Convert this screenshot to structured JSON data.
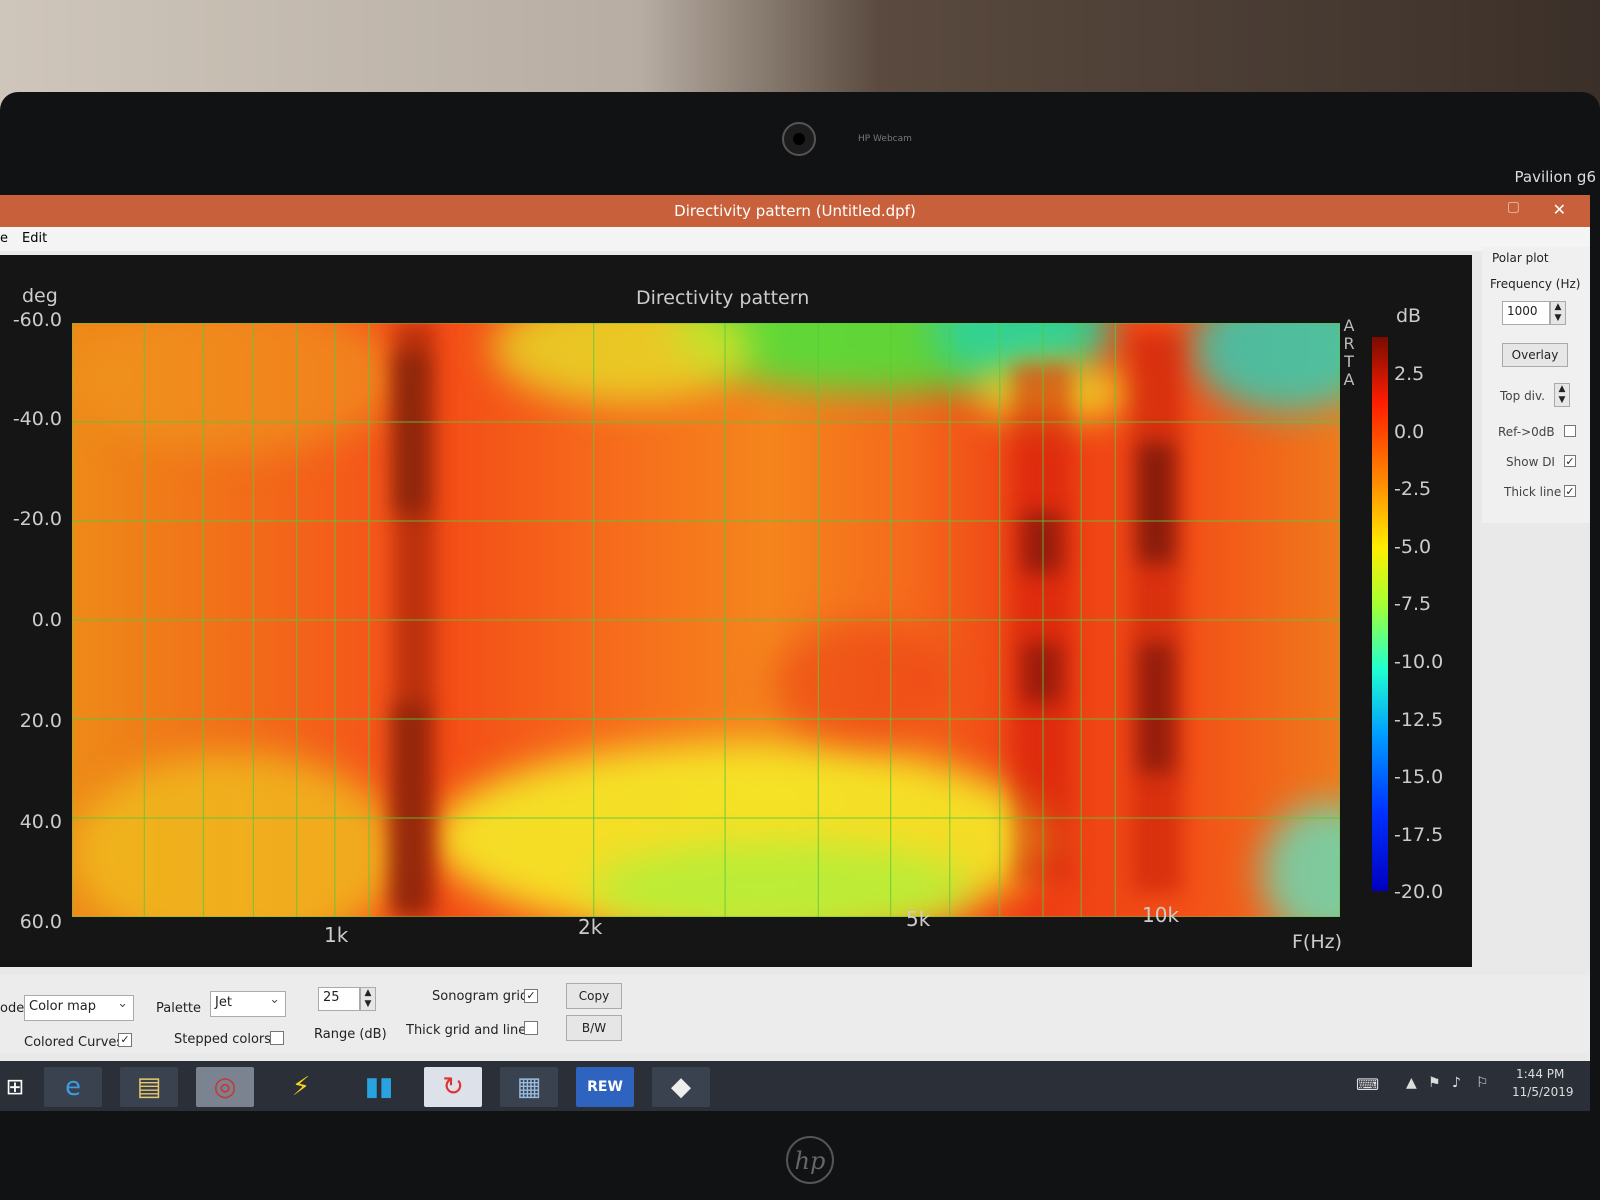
{
  "laptop": {
    "brand_label": "Pavilion g6",
    "cam_label": "HP Webcam",
    "logo": "hp"
  },
  "window": {
    "title": "Directivity pattern (Untitled.dpf)",
    "close_glyph": "✕",
    "maximize_glyph": "▢"
  },
  "menu": {
    "items": [
      "e",
      "Edit"
    ]
  },
  "chart": {
    "title": "Directivity pattern",
    "ylabel": "deg",
    "xlabel": "F(Hz)",
    "watermark": [
      "A",
      "R",
      "T",
      "A"
    ],
    "colorbar_label": "dB",
    "colorbar_ticks": [
      "2.5",
      "0.0",
      "-2.5",
      "-5.0",
      "-7.5",
      "-10.0",
      "-12.5",
      "-15.0",
      "-17.5",
      "-20.0"
    ]
  },
  "chart_data": {
    "type": "heatmap",
    "title": "Directivity pattern",
    "xlabel": "F(Hz)",
    "ylabel": "deg",
    "x_scale": "log",
    "x_ticks": [
      {
        "label": "1k",
        "value": 1000
      },
      {
        "label": "2k",
        "value": 2000
      },
      {
        "label": "5k",
        "value": 5000
      },
      {
        "label": "10k",
        "value": 10000
      }
    ],
    "y_ticks": [
      -60.0,
      -40.0,
      -20.0,
      0.0,
      20.0,
      40.0,
      60.0
    ],
    "y_tick_labels": [
      "-60.0",
      "-40.0",
      "-20.0",
      "0.0",
      "20.0",
      "40.0",
      "60.0"
    ],
    "ylim": [
      -60,
      60
    ],
    "colorbar": {
      "label": "dB",
      "range": [
        -20.0,
        2.5
      ],
      "palette": "Jet"
    },
    "grid": true
  },
  "side_panel": {
    "section": "Polar plot",
    "freq_label": "Frequency (Hz)",
    "freq_value": "1000",
    "overlay": "Overlay",
    "topdiv": "Top div.",
    "ref": "Ref->0dB",
    "showdi": "Show DI",
    "thick": "Thick line",
    "ref_checked": "",
    "showdi_checked": "✓",
    "thick_checked": "✓"
  },
  "controls": {
    "mode_label": "ode",
    "mode_value": "Color map",
    "palette_label": "Palette",
    "palette_value": "Jet",
    "range_value": "25",
    "range_label": "Range (dB)",
    "sonogram_label": "Sonogram grid",
    "sonogram_checked": "✓",
    "thickgrid_label": "Thick grid and  lines",
    "thickgrid_checked": "",
    "copy": "Copy",
    "bw": "B/W",
    "colored_label": "Colored Curves",
    "colored_checked": "✓",
    "stepped_label": "Stepped colors",
    "stepped_checked": ""
  },
  "taskbar": {
    "time": "1:44 PM",
    "date": "11/5/2019",
    "rew_label": "REW",
    "colors": {
      "bg": "#2a2f38"
    }
  }
}
